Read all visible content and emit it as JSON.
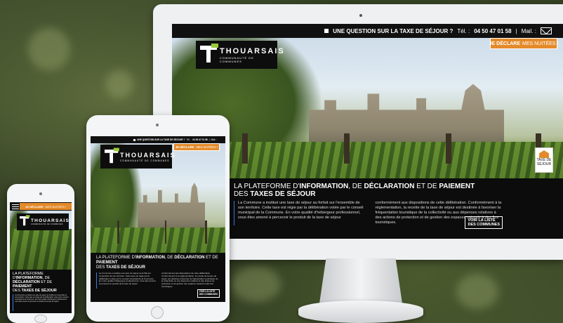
{
  "site": {
    "question": "UNE QUESTION SUR LA TAXE DE SÉJOUR ?",
    "tel_label": "Tél. :",
    "tel_number": "04 50 47 01 58",
    "separator": "|",
    "mail_label": "Mail. :",
    "declare_strong": "JE DÉCLARE",
    "declare_rest": "MES NUITÉES !",
    "logo_brand": "THOUARSAIS",
    "logo_sub": "COMMUNAUTÉ DE COMMUNES",
    "badge_label": "TAXE DE SÉJOUR",
    "headline_1": "LA PLATEFORME D'",
    "headline_2": "INFORMATION",
    "headline_3": ", DE ",
    "headline_4": "DÉCLARATION",
    "headline_5": " ET DE ",
    "headline_6": "PAIEMENT",
    "headline_7": "DES ",
    "headline_8": "TAXES DE SÉJOUR",
    "col1": "La Commune a institué une taxe de séjour au forfait sur l'ensemble de son territoire. Cette taxe est régie par la délibération votée par le conseil municipal de la Commune. En votre qualité d'hébergeur professionnel, vous êtes amené à percevoir le produit de la taxe de séjour",
    "col2": "conformément aux dispositions de cette délibération. Conformément à la réglementation, la recette de la taxe de séjour est destinée à favoriser la fréquentation touristique de la collectivité ou aux dépenses relatives à des actions de protection et de gestion des espaces naturels à des fins touristiques.",
    "voir_1": "VOIR LA LISTE",
    "voir_2": "DES COMMUNES"
  },
  "colors": {
    "accent": "#e48a2a",
    "logo_green": "#9acb3c",
    "panel_bg": "#0c0c0c",
    "column_rule": "#3a7be0"
  }
}
